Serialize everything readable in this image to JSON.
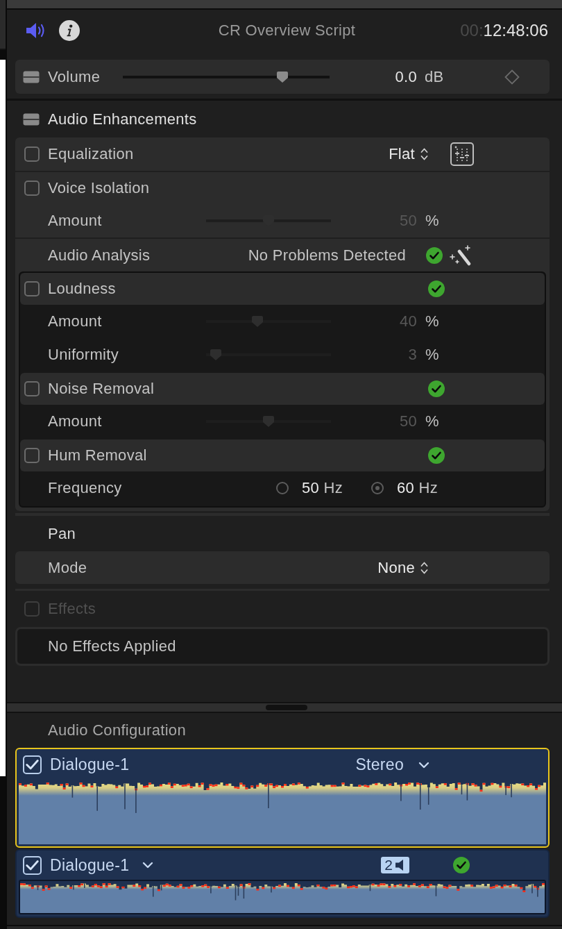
{
  "tabs": [
    {
      "kind": "audio",
      "selected": true
    },
    {
      "kind": "info",
      "selected": false
    }
  ],
  "header": {
    "title": "CR Overview Script",
    "timecode_dim": "00:",
    "timecode": "12:48:06"
  },
  "volume": {
    "label": "Volume",
    "level": 0.79,
    "value": "0.0",
    "unit": "dB"
  },
  "enhancements": {
    "title": "Audio Enhancements",
    "equalization": {
      "label": "Equalization",
      "checked": false,
      "preset": "Flat"
    },
    "voice_isolation": {
      "label": "Voice Isolation",
      "checked": false,
      "params": [
        {
          "kind": "slider",
          "label": "Amount",
          "level": 0.5,
          "value": "50",
          "unit": "%"
        }
      ]
    },
    "analysis": {
      "label": "Audio Analysis",
      "status": "No Problems Detected",
      "ok": true
    },
    "groups": [
      {
        "label": "Loudness",
        "checked": false,
        "ok": true,
        "params": [
          {
            "kind": "slider",
            "label": "Amount",
            "level": 0.4,
            "value": "40",
            "unit": "%"
          },
          {
            "kind": "slider",
            "label": "Uniformity",
            "level": 0.03,
            "value": "3",
            "unit": "%"
          }
        ]
      },
      {
        "label": "Noise Removal",
        "checked": false,
        "ok": true,
        "params": [
          {
            "kind": "slider",
            "label": "Amount",
            "level": 0.5,
            "value": "50",
            "unit": "%"
          }
        ]
      },
      {
        "label": "Hum Removal",
        "checked": false,
        "ok": true,
        "params": [
          {
            "kind": "radio",
            "label": "Frequency",
            "options": [
              {
                "value": "50",
                "unit": "Hz",
                "selected": false
              },
              {
                "value": "60",
                "unit": "Hz",
                "selected": true
              }
            ]
          }
        ]
      }
    ]
  },
  "pan": {
    "title": "Pan",
    "mode": {
      "label": "Mode",
      "value": "None"
    }
  },
  "effects": {
    "label": "Effects",
    "checked": false,
    "disabled": true,
    "empty_text": "No Effects Applied"
  },
  "audio_configuration": {
    "title": "Audio Configuration",
    "components": [
      {
        "kind": "clip",
        "name": "Dialogue-1",
        "checked": true,
        "selected": true,
        "format": "Stereo"
      },
      {
        "kind": "channel",
        "name": "Dialogue-1",
        "checked": true,
        "selected": false,
        "channel_count": "2",
        "ok": true
      }
    ]
  }
}
